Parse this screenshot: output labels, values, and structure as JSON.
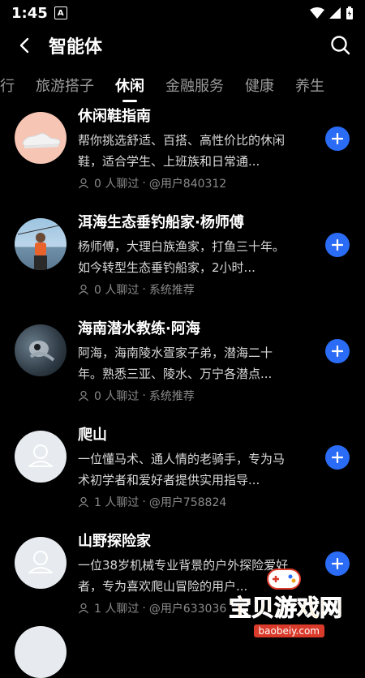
{
  "status": {
    "time": "1:45",
    "a_icon_letter": "A"
  },
  "header": {
    "title": "智能体"
  },
  "tabs": [
    {
      "label": "出行"
    },
    {
      "label": "旅游搭子"
    },
    {
      "label": "休闲"
    },
    {
      "label": "金融服务"
    },
    {
      "label": "健康"
    },
    {
      "label": "养生"
    }
  ],
  "items": [
    {
      "name": "休闲鞋指南",
      "desc": "帮你挑选舒适、百搭、高性价比的休闲鞋，适合学生、上班族和日常通...",
      "chats": "0 人聊过",
      "sep": "·",
      "source": "@用户840312"
    },
    {
      "name": "洱海生态垂钓船家·杨师傅",
      "desc": "杨师傅，大理白族渔家，打鱼三十年。如今转型生态垂钓船家，2小时...",
      "chats": "0 人聊过",
      "sep": "·",
      "source": "系统推荐"
    },
    {
      "name": "海南潜水教练·阿海",
      "desc": "阿海，海南陵水疍家子弟，潜海二十年。熟悉三亚、陵水、万宁各潜点...",
      "chats": "0 人聊过",
      "sep": "·",
      "source": "系统推荐"
    },
    {
      "name": "爬山",
      "desc": "一位懂马术、通人情的老骑手，专为马术初学者和爱好者提供实用指导...",
      "chats": "1 人聊过",
      "sep": "·",
      "source": "@用户758824"
    },
    {
      "name": "山野探险家",
      "desc": "一位38岁机械专业背景的户外探险爱好者，专为喜欢爬山冒险的用户...",
      "chats": "1 人聊过",
      "sep": "·",
      "source": "@用户633036"
    }
  ],
  "watermark": {
    "text": "宝贝游戏网",
    "url": "baobeiy.com"
  },
  "colors": {
    "accent": "#2b6cf6",
    "background": "#000000"
  }
}
